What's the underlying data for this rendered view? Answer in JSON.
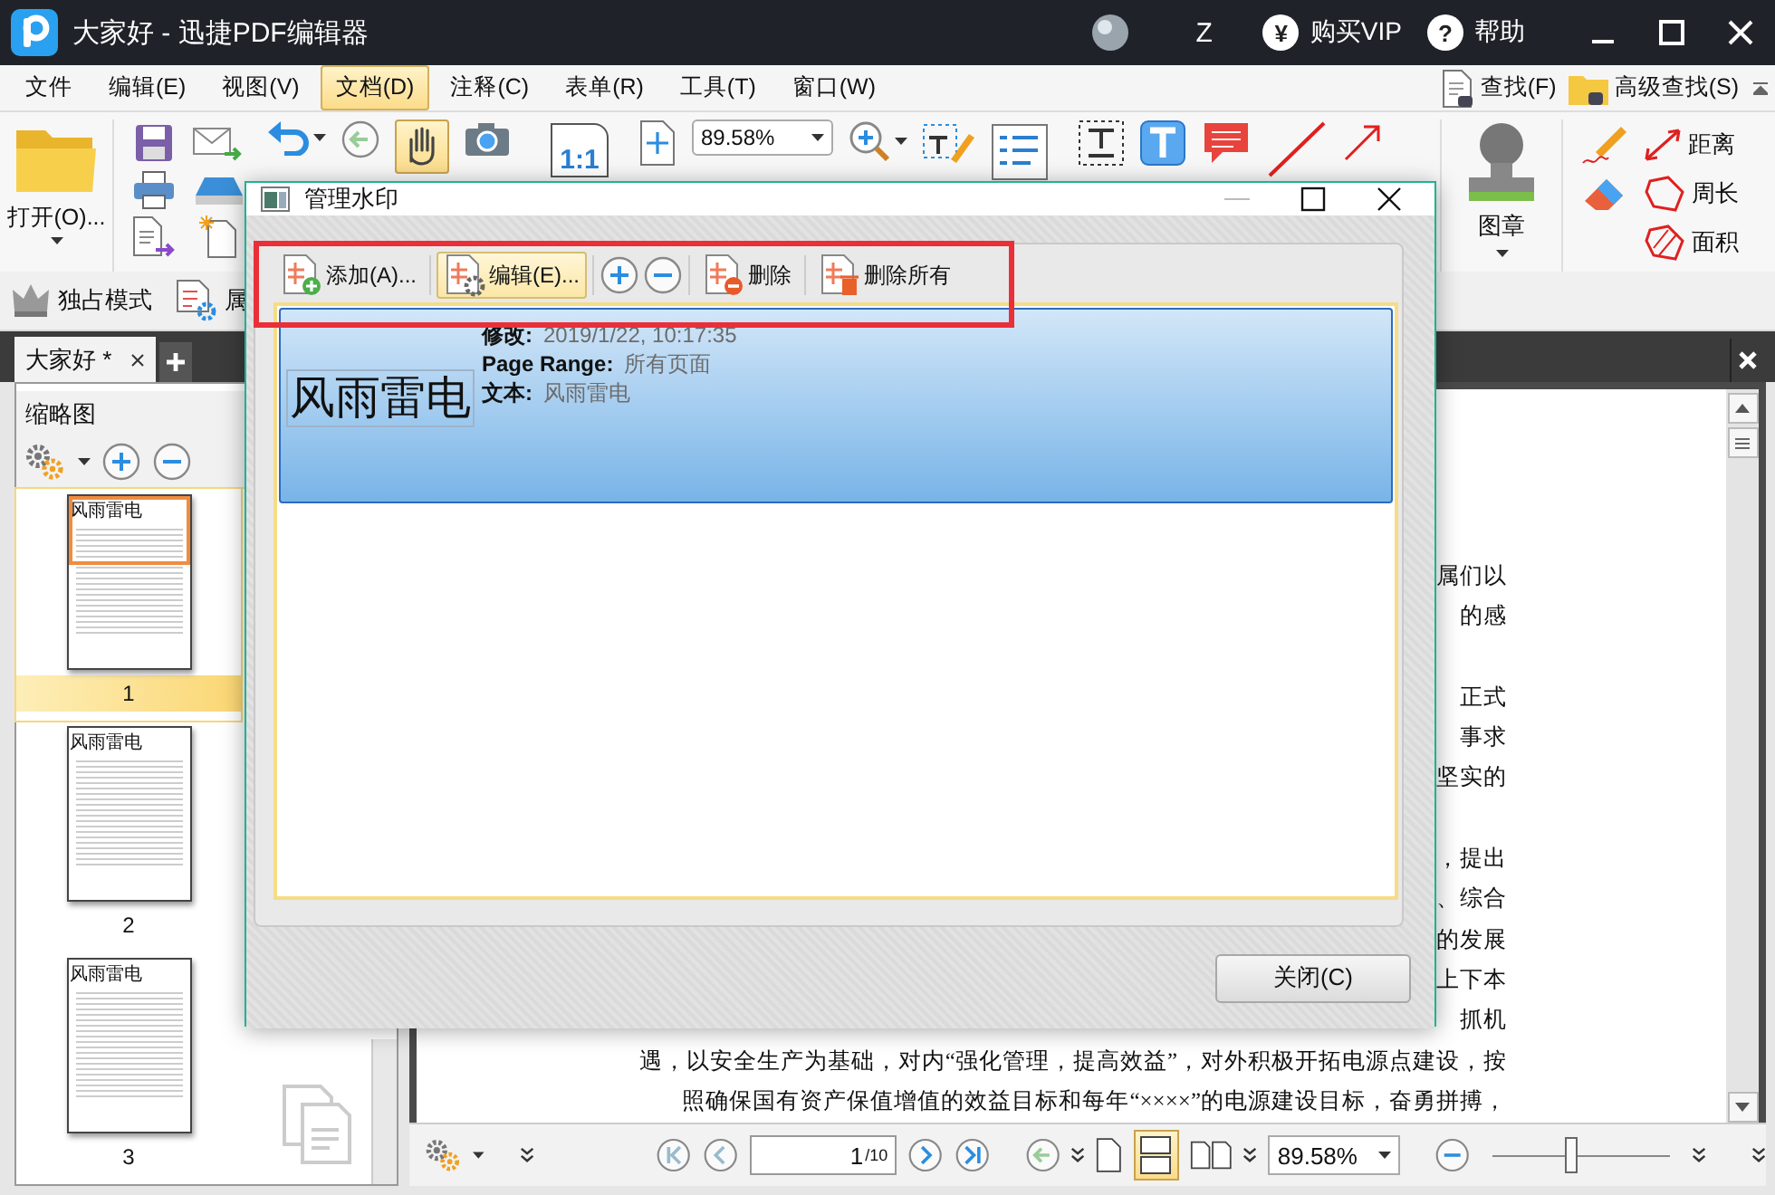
{
  "window": {
    "title": "大家好 - 迅捷PDF编辑器",
    "user_initial": "Z",
    "vip_glyph": "¥",
    "vip_label": "购买VIP",
    "help_glyph": "?",
    "help_label": "帮助"
  },
  "menu": {
    "items": [
      {
        "label": "文件",
        "selected": false
      },
      {
        "label": "编辑(E)",
        "selected": false
      },
      {
        "label": "视图(V)",
        "selected": false
      },
      {
        "label": "文档(D)",
        "selected": true
      },
      {
        "label": "注释(C)",
        "selected": false
      },
      {
        "label": "表单(R)",
        "selected": false
      },
      {
        "label": "工具(T)",
        "selected": false
      },
      {
        "label": "窗口(W)",
        "selected": false
      }
    ],
    "find_label": "查找(F)",
    "advanced_find_label": "高级查找(S)"
  },
  "ribbon": {
    "open_label": "打开(O)...",
    "actual_size_label": "1:1",
    "zoom_value": "89.58%",
    "stamp_label": "图章",
    "measure_labels": [
      "距离",
      "周长",
      "面积"
    ],
    "exclusive_mode_label": "独占模式",
    "properties_label": "属"
  },
  "document_tabs": [
    {
      "label": "大家好 *",
      "selected": true
    }
  ],
  "thumbnails": {
    "title": "缩略图",
    "pages": [
      {
        "number": "1",
        "heading": "风雨雷电",
        "selected": true
      },
      {
        "number": "2",
        "heading": "风雨雷电",
        "selected": false
      },
      {
        "number": "3",
        "heading": "风雨雷电",
        "selected": false
      }
    ]
  },
  "document": {
    "paragraphs": [
      [
        "属们以",
        "的感"
      ],
      [
        "正式",
        "事求",
        "坚实的"
      ],
      [
        "，提出",
        "、综合",
        "的发展",
        "上下本",
        "抓机",
        "遇，以安全生产为基础，对内“强化管理，提高效益”，对外积极开拓电源点建设，按",
        "照确保国有资产保值增值的效益目标和每年“××××”的电源建设目标，奋勇拼搏，"
      ]
    ]
  },
  "bottom_bar": {
    "page_value": "1",
    "page_total": "/10",
    "zoom_value": "89.58%",
    "zoom_slider": {
      "level": 0.45
    }
  },
  "dialog": {
    "title": "管理水印",
    "toolbar": [
      {
        "kind": "add",
        "label": "添加(A)...",
        "selected": false
      },
      {
        "kind": "edit",
        "label": "编辑(E)...",
        "selected": true
      },
      {
        "kind": "zoom-in"
      },
      {
        "kind": "zoom-out"
      },
      {
        "kind": "delete",
        "label": "删除",
        "selected": false
      },
      {
        "kind": "delete-all",
        "label": "删除所有",
        "selected": false
      }
    ],
    "watermarks": [
      {
        "preview": "风雨雷电",
        "selected": true,
        "fields": [
          {
            "label": "修改:",
            "value": "2019/1/22, 10:17:35"
          },
          {
            "label": "Page Range:",
            "value": "所有页面"
          },
          {
            "label": "文本:",
            "value": "风雨雷电"
          }
        ]
      }
    ],
    "close_button": "关闭(C)"
  }
}
